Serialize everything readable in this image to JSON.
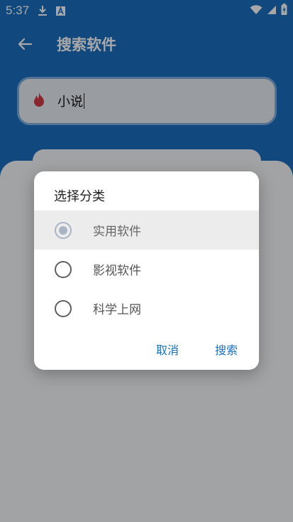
{
  "status_bar": {
    "time": "5:37",
    "left_icons": [
      "download-icon",
      "a-badge-icon"
    ],
    "right_icons": [
      "wifi-icon",
      "cellular-icon",
      "battery-icon"
    ]
  },
  "app_bar": {
    "title": "搜索软件"
  },
  "search": {
    "value": "小说"
  },
  "dialog": {
    "title": "选择分类",
    "options": [
      {
        "label": "实用软件",
        "selected": true
      },
      {
        "label": "影视软件",
        "selected": false
      },
      {
        "label": "科学上网",
        "selected": false
      }
    ],
    "cancel_label": "取消",
    "search_label": "搜索"
  },
  "colors": {
    "primary": "#1a6fbf",
    "accent_action": "#1a6fbf",
    "search_icon": "#d23a4a"
  }
}
